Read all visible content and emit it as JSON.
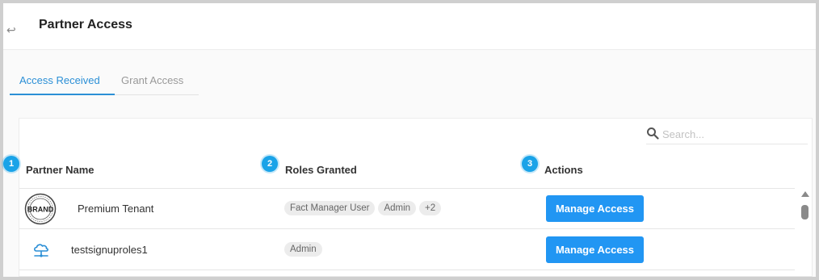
{
  "header": {
    "title": "Partner Access",
    "back_icon": "return-arrow-icon"
  },
  "tabs": [
    {
      "label": "Access Received",
      "active": true
    },
    {
      "label": "Grant Access",
      "active": false
    }
  ],
  "search": {
    "placeholder": "Search...",
    "value": "",
    "icon": "search-icon"
  },
  "table": {
    "columns": [
      "Partner Name",
      "Roles Granted",
      "Actions"
    ],
    "rows": [
      {
        "name": "Premium Tenant",
        "logo_text": "BRAND",
        "roles": [
          "Fact Manager User",
          "Admin",
          "+2"
        ],
        "action": "Manage Access"
      },
      {
        "name": "testsignuproles1",
        "icon": "cloud-network-icon",
        "roles": [
          "Admin"
        ],
        "action": "Manage Access"
      }
    ]
  },
  "markers": [
    "1",
    "2",
    "3"
  ],
  "colors": {
    "accent": "#2b8fd6",
    "button": "#2196f3",
    "marker": "#1aa3e8"
  }
}
